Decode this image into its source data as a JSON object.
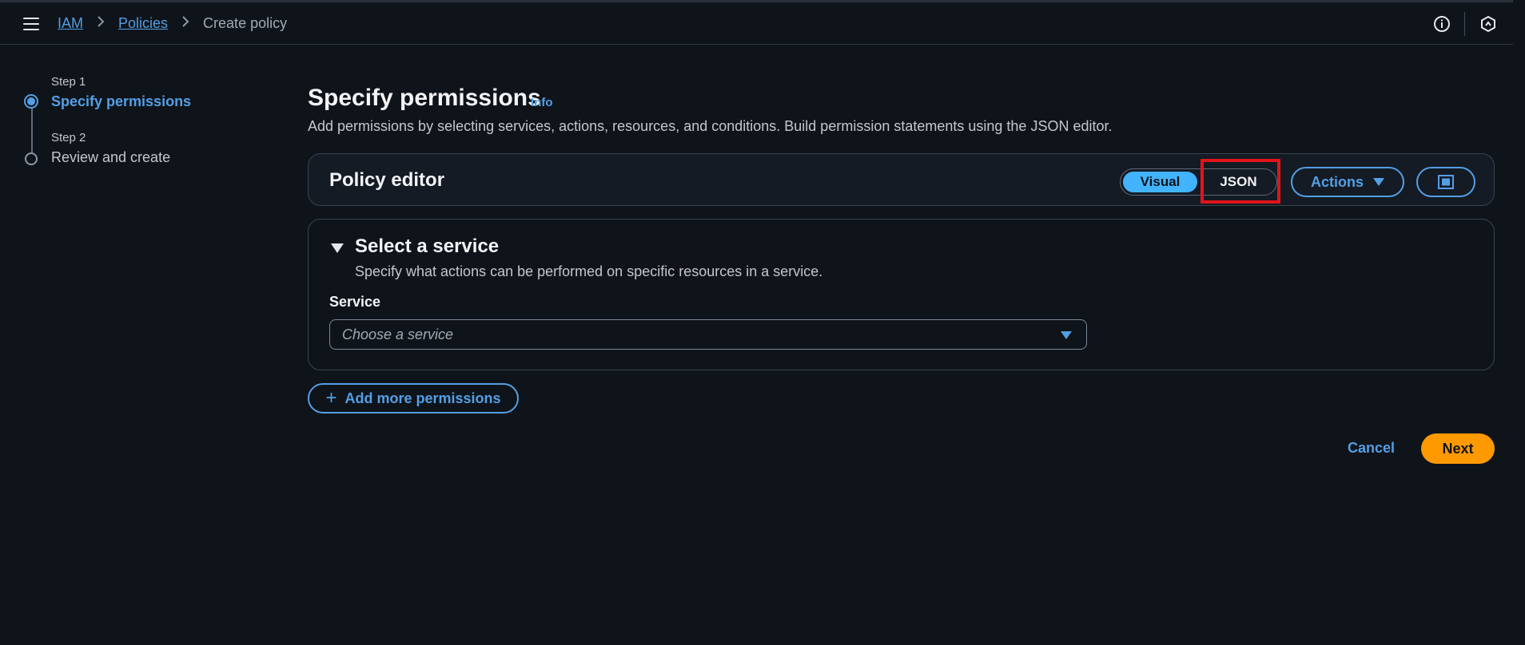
{
  "header": {
    "breadcrumb": [
      "IAM",
      "Policies",
      "Create policy"
    ],
    "icons": {
      "menu": "hamburger-menu-icon",
      "info": "info-icon",
      "security": "shield-hex-icon"
    }
  },
  "steps": [
    {
      "label": "Step 1",
      "title": "Specify permissions",
      "active": true
    },
    {
      "label": "Step 2",
      "title": "Review and create",
      "active": false
    }
  ],
  "main": {
    "title": "Specify permissions",
    "info": "Info",
    "description": "Add permissions by selecting services, actions, resources, and conditions. Build permission statements using the JSON editor."
  },
  "policy_editor": {
    "title": "Policy editor",
    "modes": [
      "Visual",
      "JSON"
    ],
    "selected_mode": "Visual",
    "actions_label": "Actions"
  },
  "service_section": {
    "title": "Select a service",
    "description": "Specify what actions can be performed on specific resources in a service.",
    "field_label": "Service",
    "placeholder": "Choose a service"
  },
  "add_more_label": "Add more permissions",
  "footer": {
    "cancel_label": "Cancel",
    "next_label": "Next"
  },
  "colors": {
    "accent": "#539fe5",
    "primary_button": "#ff9900",
    "toggle_selected": "#42b4ff",
    "highlight": "#e0141b",
    "background": "#0f141a"
  }
}
